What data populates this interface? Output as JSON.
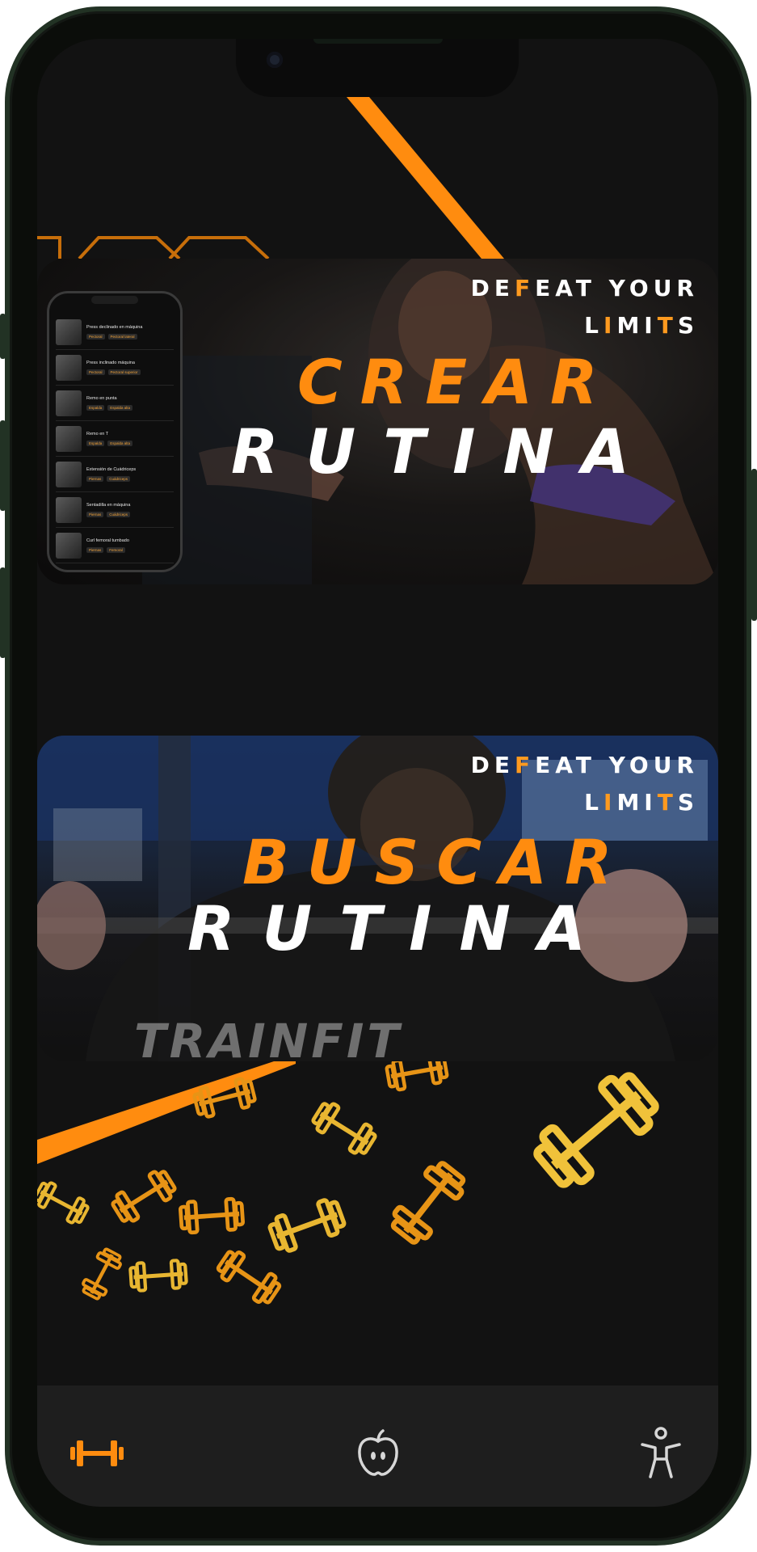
{
  "banners": [
    {
      "tagline_line1": [
        "DE",
        "F",
        "EAT YOUR"
      ],
      "tagline_line2": [
        "L",
        "I",
        "MI",
        "T",
        "S"
      ],
      "title_top": "CREAR",
      "title_bottom": "RUTINA"
    },
    {
      "tagline_line1": [
        "DE",
        "F",
        "EAT YOUR"
      ],
      "tagline_line2": [
        "L",
        "I",
        "MI",
        "T",
        "S"
      ],
      "title_top": "BUSCAR",
      "title_bottom": "RUTINA",
      "shirt_text": "TRAINFIT"
    }
  ],
  "mini_phone_list": [
    {
      "title": "Press declinado en máquina",
      "tags": [
        "Pectoral",
        "Pectoral lateral"
      ]
    },
    {
      "title": "Press inclinado máquina",
      "tags": [
        "Pectoral",
        "Pectoral superior"
      ]
    },
    {
      "title": "Remo en punta",
      "tags": [
        "Espalda",
        "Espalda alta"
      ]
    },
    {
      "title": "Remo en T",
      "tags": [
        "Espalda",
        "Espalda alta"
      ]
    },
    {
      "title": "Extensión de Cuádriceps",
      "tags": [
        "Piernas",
        "Cuádriceps"
      ]
    },
    {
      "title": "Sentadilla en máquina",
      "tags": [
        "Piernas",
        "Cuádriceps"
      ]
    },
    {
      "title": "Curl femoral tumbado",
      "tags": [
        "Piernas",
        "Femoral"
      ]
    }
  ],
  "tabbar": {
    "items": [
      {
        "icon": "dumbbell-icon",
        "active": true
      },
      {
        "icon": "apple-icon",
        "active": false
      },
      {
        "icon": "accessibility-person-icon",
        "active": false
      }
    ]
  },
  "colors": {
    "accent": "#ff8c0f",
    "background": "#121212",
    "tabbar": "#1e1e1e",
    "frame": "#223224"
  }
}
